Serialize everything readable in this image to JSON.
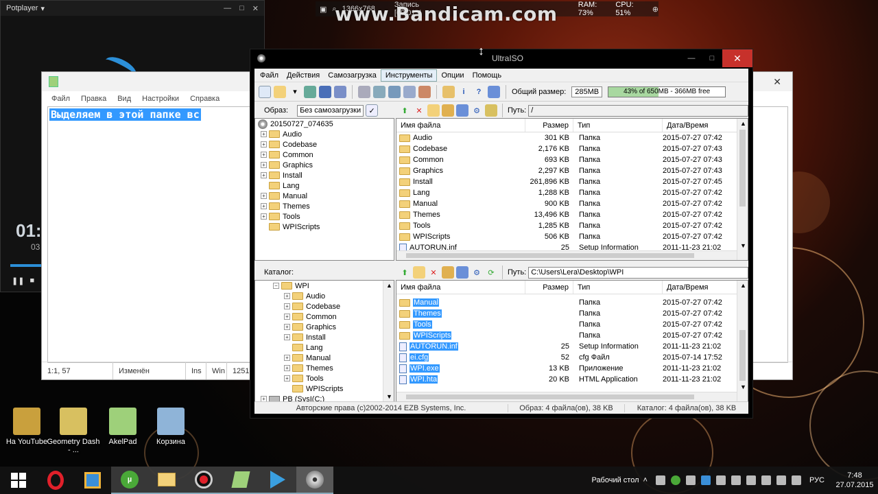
{
  "watermark": "www.Bandicam.com",
  "recbar": {
    "resolution": "1366x768",
    "record": "Запись [00:01:4",
    "ram": "RAM: 73%",
    "cpu": "CPU: 51%"
  },
  "potplayer": {
    "title": "Potplayer",
    "time_main": "01:",
    "time_sub": "03"
  },
  "akelpad": {
    "menu": [
      "Файл",
      "Правка",
      "Вид",
      "Настройки",
      "Справка"
    ],
    "selected_text": "Выделяем в этой папке вс",
    "status": {
      "pos": "1:1, 57",
      "modified": "Изменён",
      "ins": "Ins",
      "eol": "Win",
      "codepage": "1251"
    }
  },
  "ultraiso": {
    "title": "UltraISO",
    "menu": [
      "Файл",
      "Действия",
      "Самозагрузка",
      "Инструменты",
      "Опции",
      "Помощь"
    ],
    "total_size_label": "Общий размер:",
    "total_size_value": "285MB",
    "capacity_text": "43% of 650MB - 366MB free",
    "capacity_fraction": 0.43,
    "image_label": "Образ:",
    "boot_tooltip": "Без самозагрузки",
    "path_label": "Путь:",
    "iso_path": "/",
    "catalog_label": "Каталог:",
    "catalog_path": "C:\\Users\\Lera\\Desktop\\WPI",
    "iso_tree": {
      "root": "20150727_074635",
      "items": [
        {
          "name": "Audio",
          "exp": true
        },
        {
          "name": "Codebase",
          "exp": true
        },
        {
          "name": "Common",
          "exp": true
        },
        {
          "name": "Graphics",
          "exp": true
        },
        {
          "name": "Install",
          "exp": true
        },
        {
          "name": "Lang",
          "exp": false
        },
        {
          "name": "Manual",
          "exp": true
        },
        {
          "name": "Themes",
          "exp": true
        },
        {
          "name": "Tools",
          "exp": true
        },
        {
          "name": "WPIScripts",
          "exp": false
        }
      ]
    },
    "columns": [
      "Имя файла",
      "Размер",
      "Тип",
      "Дата/Время"
    ],
    "iso_files": [
      [
        "Audio",
        "301 KB",
        "Папка",
        "2015-07-27 07:42"
      ],
      [
        "Codebase",
        "2,176 KB",
        "Папка",
        "2015-07-27 07:43"
      ],
      [
        "Common",
        "693 KB",
        "Папка",
        "2015-07-27 07:43"
      ],
      [
        "Graphics",
        "2,297 KB",
        "Папка",
        "2015-07-27 07:43"
      ],
      [
        "Install",
        "261,896 KB",
        "Папка",
        "2015-07-27 07:45"
      ],
      [
        "Lang",
        "1,288 KB",
        "Папка",
        "2015-07-27 07:42"
      ],
      [
        "Manual",
        "900 KB",
        "Папка",
        "2015-07-27 07:42"
      ],
      [
        "Themes",
        "13,496 KB",
        "Папка",
        "2015-07-27 07:42"
      ],
      [
        "Tools",
        "1,285 KB",
        "Папка",
        "2015-07-27 07:42"
      ],
      [
        "WPIScripts",
        "506 KB",
        "Папка",
        "2015-07-27 07:42"
      ],
      [
        "AUTORUN.inf",
        "25",
        "Setup Information",
        "2011-11-23 21:02"
      ]
    ],
    "local_tree": {
      "parent": "WPI",
      "items": [
        {
          "name": "Audio",
          "exp": true
        },
        {
          "name": "Codebase",
          "exp": true
        },
        {
          "name": "Common",
          "exp": true
        },
        {
          "name": "Graphics",
          "exp": true
        },
        {
          "name": "Install",
          "exp": true
        },
        {
          "name": "Lang",
          "exp": false
        },
        {
          "name": "Manual",
          "exp": true
        },
        {
          "name": "Themes",
          "exp": true
        },
        {
          "name": "Tools",
          "exp": true
        },
        {
          "name": "WPIScripts",
          "exp": false
        }
      ],
      "drive": "PB (SysI(C:)"
    },
    "local_files": [
      [
        "Manual",
        "",
        "Папка",
        "2015-07-27 07:42",
        "folder"
      ],
      [
        "Themes",
        "",
        "Папка",
        "2015-07-27 07:42",
        "folder"
      ],
      [
        "Tools",
        "",
        "Папка",
        "2015-07-27 07:42",
        "folder"
      ],
      [
        "WPIScripts",
        "",
        "Папка",
        "2015-07-27 07:42",
        "folder"
      ],
      [
        "AUTORUN.inf",
        "25",
        "Setup Information",
        "2011-11-23 21:02",
        "file"
      ],
      [
        "ei.cfg",
        "52",
        "cfg Файл",
        "2015-07-14 17:52",
        "file"
      ],
      [
        "WPI.exe",
        "13 KB",
        "Приложение",
        "2011-11-23 21:02",
        "file"
      ],
      [
        "WPI.hta",
        "20 KB",
        "HTML Application",
        "2011-11-23 21:02",
        "file"
      ]
    ],
    "status": {
      "copyright": "Авторские права (c)2002-2014 EZB Systems, Inc.",
      "image_info": "Образ: 4 файла(ов), 38 KB",
      "catalog_info": "Каталог: 4 файла(ов), 38 KB"
    }
  },
  "desktop_icons": [
    {
      "label": "На YouTube",
      "color": "#c9a03d"
    },
    {
      "label": "Geometry Dash - ...",
      "color": "#d8c060"
    },
    {
      "label": "AkelPad",
      "color": "#9ed07a"
    },
    {
      "label": "Корзина",
      "color": "#8fb4d8"
    }
  ],
  "taskbar": {
    "desktop_label": "Рабочий стол",
    "lang": "РУС",
    "time": "7:48",
    "date": "27.07.2015"
  }
}
